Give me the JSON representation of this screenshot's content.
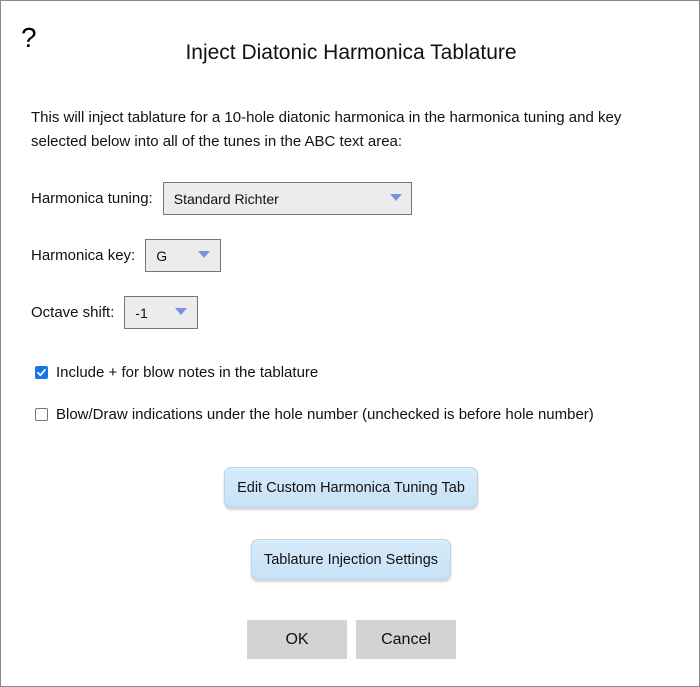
{
  "dialog": {
    "help_glyph": "?",
    "title": "Inject Diatonic Harmonica Tablature",
    "description": "This will inject tablature for a 10-hole diatonic harmonica in the harmonica tuning and key selected below into all of the tunes in the ABC text area:"
  },
  "tuning": {
    "label": "Harmonica tuning:",
    "value": "Standard Richter"
  },
  "key": {
    "label": "Harmonica key:",
    "value": "G"
  },
  "octave": {
    "label": "Octave shift:",
    "value": "-1"
  },
  "options": {
    "include_plus": {
      "label": "Include + for blow notes in the tablature",
      "checked": true
    },
    "under_hole": {
      "label": "Blow/Draw indications under the hole number (unchecked is before hole number)",
      "checked": false
    }
  },
  "buttons": {
    "edit_custom": "Edit Custom Harmonica Tuning Tab",
    "injection_settings": "Tablature Injection Settings",
    "ok": "OK",
    "cancel": "Cancel"
  },
  "colors": {
    "dropdown_arrow": "#7f8fe0",
    "checkbox_checked": "#1a73e8",
    "blue_button": "#cfe6f8",
    "grey_button": "#d3d3d3"
  }
}
